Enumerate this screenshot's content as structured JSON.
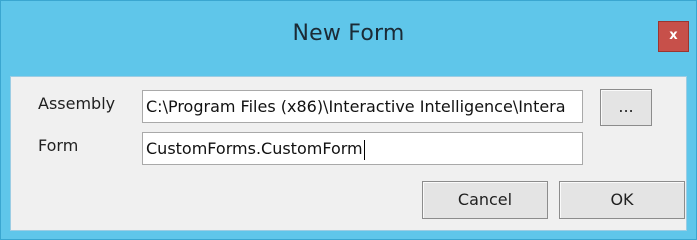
{
  "window": {
    "title": "New Form",
    "close_label": "x"
  },
  "form": {
    "assembly_label": "Assembly",
    "assembly_value": "C:\\Program Files (x86)\\Interactive Intelligence\\Intera",
    "browse_label": "...",
    "form_label": "Form",
    "form_value": "CustomForms.CustomForm"
  },
  "buttons": {
    "cancel_label": "Cancel",
    "ok_label": "OK"
  },
  "colors": {
    "title_bar": "#5fc6ea",
    "close_button": "#c7504a",
    "client_background": "#f0f0f0"
  }
}
